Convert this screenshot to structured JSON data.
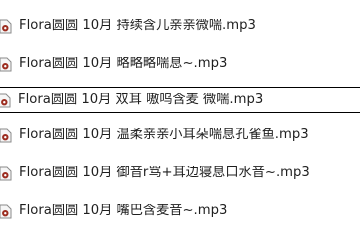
{
  "file_list": {
    "icon": "audio-file-icon",
    "accent_color": "#9c2c1f",
    "items": [
      {
        "name": "Flora圆圆 10月 持续含儿亲亲微喘.mp3",
        "selected": false
      },
      {
        "name": "Flora圆圆 10月 略略略喘息~.mp3",
        "selected": false
      },
      {
        "name": "Flora圆圆 10月 双耳 嗷呜含麦 微喘.mp3",
        "selected": true
      },
      {
        "name": "Flora圆圆 10月 温柔亲亲小耳朵喘息孔雀鱼.mp3",
        "selected": false
      },
      {
        "name": "Flora圆圆 10月 御音r骂+耳边寝息口水音~.mp3",
        "selected": false
      },
      {
        "name": "Flora圆圆 10月 嘴巴含麦音~.mp3",
        "selected": false
      }
    ]
  }
}
